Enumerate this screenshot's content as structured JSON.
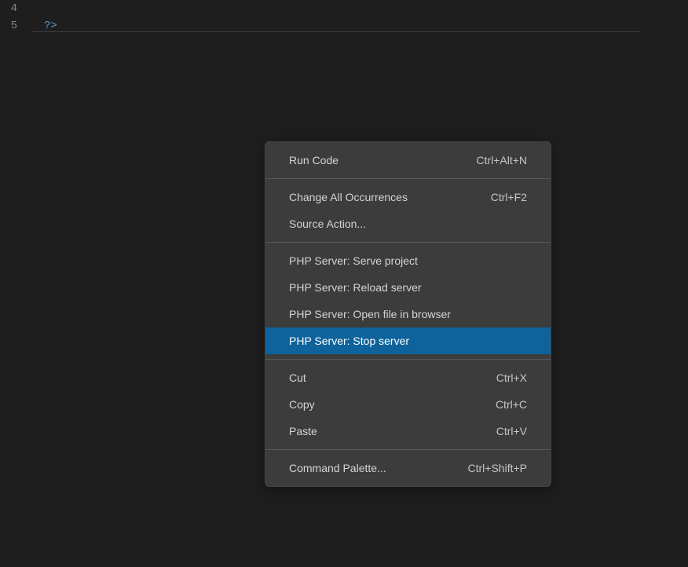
{
  "editor": {
    "lines": [
      {
        "number": "4",
        "content": ""
      },
      {
        "number": "5",
        "content": "?>"
      }
    ]
  },
  "context_menu": {
    "groups": [
      [
        {
          "label": "Run Code",
          "shortcut": "Ctrl+Alt+N",
          "highlighted": false
        }
      ],
      [
        {
          "label": "Change All Occurrences",
          "shortcut": "Ctrl+F2",
          "highlighted": false
        },
        {
          "label": "Source Action...",
          "shortcut": "",
          "highlighted": false
        }
      ],
      [
        {
          "label": "PHP Server: Serve project",
          "shortcut": "",
          "highlighted": false
        },
        {
          "label": "PHP Server: Reload server",
          "shortcut": "",
          "highlighted": false
        },
        {
          "label": "PHP Server: Open file in browser",
          "shortcut": "",
          "highlighted": false
        },
        {
          "label": "PHP Server: Stop server",
          "shortcut": "",
          "highlighted": true
        }
      ],
      [
        {
          "label": "Cut",
          "shortcut": "Ctrl+X",
          "highlighted": false
        },
        {
          "label": "Copy",
          "shortcut": "Ctrl+C",
          "highlighted": false
        },
        {
          "label": "Paste",
          "shortcut": "Ctrl+V",
          "highlighted": false
        }
      ],
      [
        {
          "label": "Command Palette...",
          "shortcut": "Ctrl+Shift+P",
          "highlighted": false
        }
      ]
    ]
  }
}
